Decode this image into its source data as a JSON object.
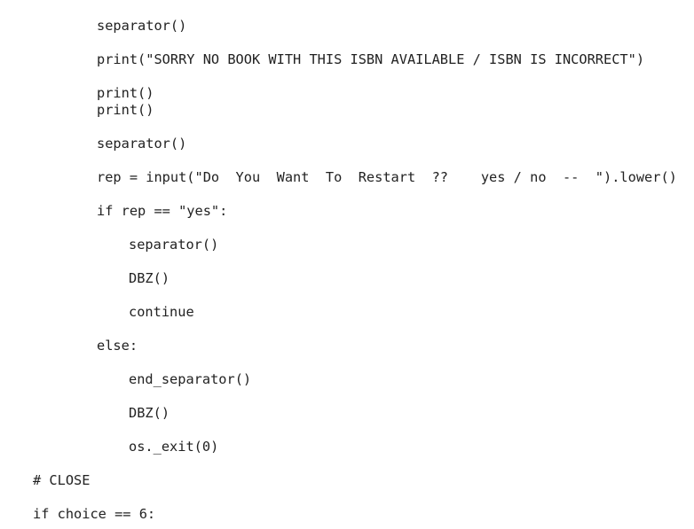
{
  "code": {
    "lines": [
      "separator()",
      "print(\"SORRY NO BOOK WITH THIS ISBN AVAILABLE / ISBN IS INCORRECT\")",
      "print()",
      "print()",
      "separator()",
      "rep = input(\"Do  You  Want  To  Restart  ??    yes / no  --  \").lower()",
      "if rep == \"yes\":",
      "separator()",
      "DBZ()",
      "continue",
      "else:",
      "end_separator()",
      "DBZ()",
      "os._exit(0)",
      "# CLOSE",
      "if choice == 6:"
    ]
  }
}
